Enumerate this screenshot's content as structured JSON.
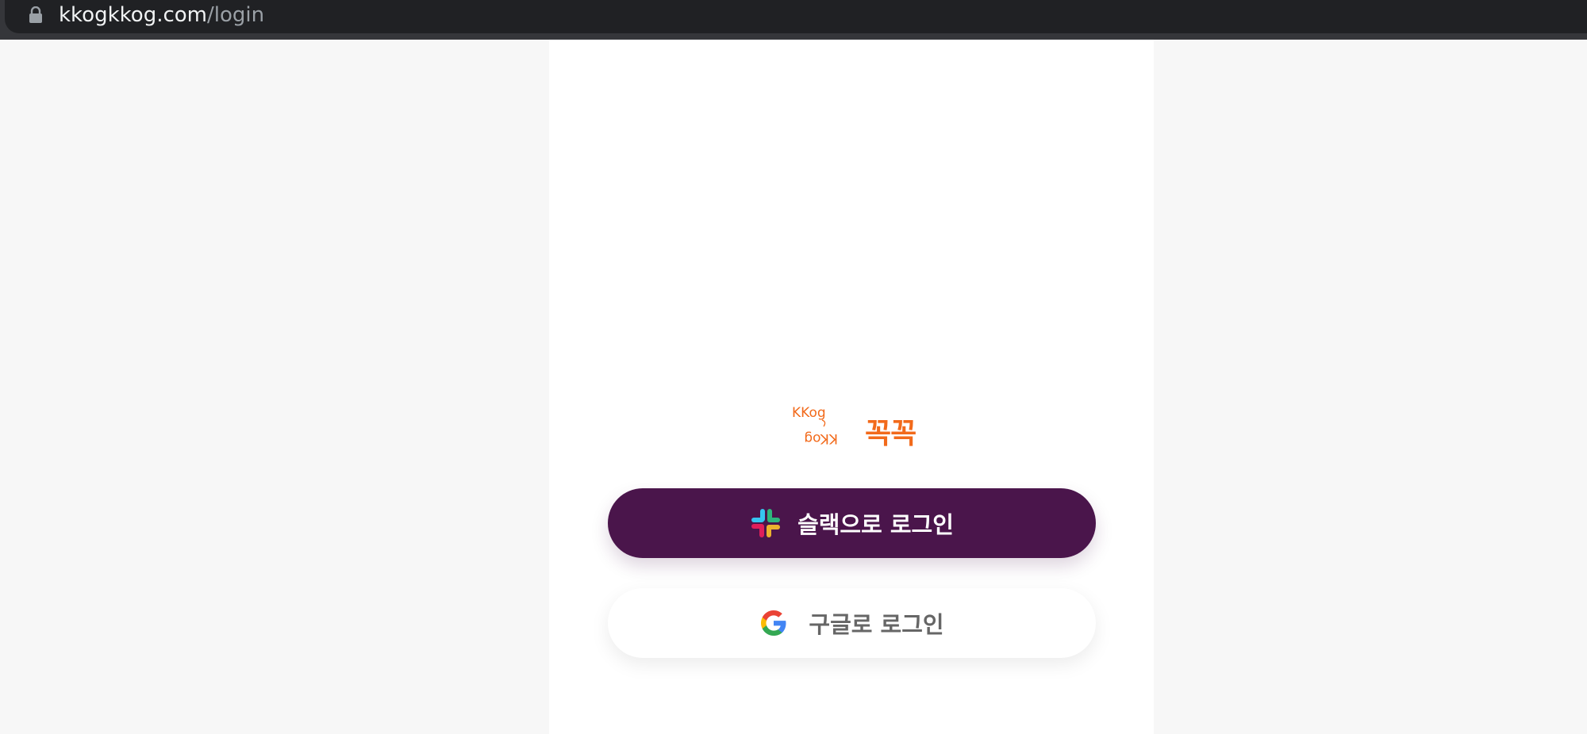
{
  "browser": {
    "url_host": "kkogkkog.com",
    "url_path": "/login",
    "lock_icon": "lock-icon"
  },
  "logo": {
    "mark_top_text": "KKog",
    "mark_bottom_text": "KKog",
    "wordmark": "꼭꼭",
    "brand_color": "#f26a1b"
  },
  "buttons": {
    "slack": {
      "label": "슬랙으로 로그인",
      "icon": "slack-icon",
      "background": "#4a154b",
      "text_color": "#ffffff"
    },
    "google": {
      "label": "구글로 로그인",
      "icon": "google-icon",
      "background": "#ffffff",
      "text_color": "#666666"
    }
  }
}
